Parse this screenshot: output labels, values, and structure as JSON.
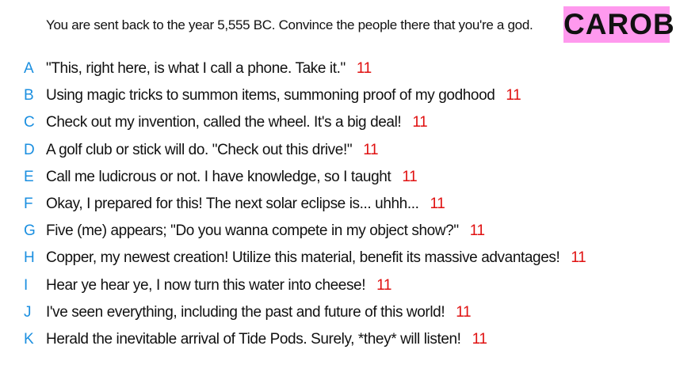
{
  "prompt": "You are sent back to the year 5,555 BC. Convince the people there that you're a god.",
  "tag": "CAROB",
  "answers": [
    {
      "letter": "A",
      "text": "\"This, right here, is what I call a phone. Take it.\"",
      "score": "11"
    },
    {
      "letter": "B",
      "text": "Using magic tricks to summon items, summoning proof of my godhood",
      "score": "11"
    },
    {
      "letter": "C",
      "text": "Check out my invention, called the wheel. It's a big deal!",
      "score": "11"
    },
    {
      "letter": "D",
      "text": "A golf club or stick will do. \"Check out this drive!\"",
      "score": "11"
    },
    {
      "letter": "E",
      "text": "Call me ludicrous or not. I have knowledge, so I taught",
      "score": "11"
    },
    {
      "letter": "F",
      "text": "Okay, I prepared for this! The next solar eclipse is... uhhh...",
      "score": "11"
    },
    {
      "letter": "G",
      "text": "Five (me) appears; \"Do you wanna compete in my object show?\"",
      "score": "11"
    },
    {
      "letter": "H",
      "text": "Copper, my newest creation! Utilize this material, benefit its massive advantages!",
      "score": "11"
    },
    {
      "letter": "I",
      "text": "Hear ye hear ye, I now turn this water into cheese!",
      "score": "11"
    },
    {
      "letter": "J",
      "text": "I've seen everything, including the past and future of this world!",
      "score": "11"
    },
    {
      "letter": "K",
      "text": "Herald the inevitable arrival of Tide Pods. Surely, *they* will listen!",
      "score": "11"
    }
  ]
}
